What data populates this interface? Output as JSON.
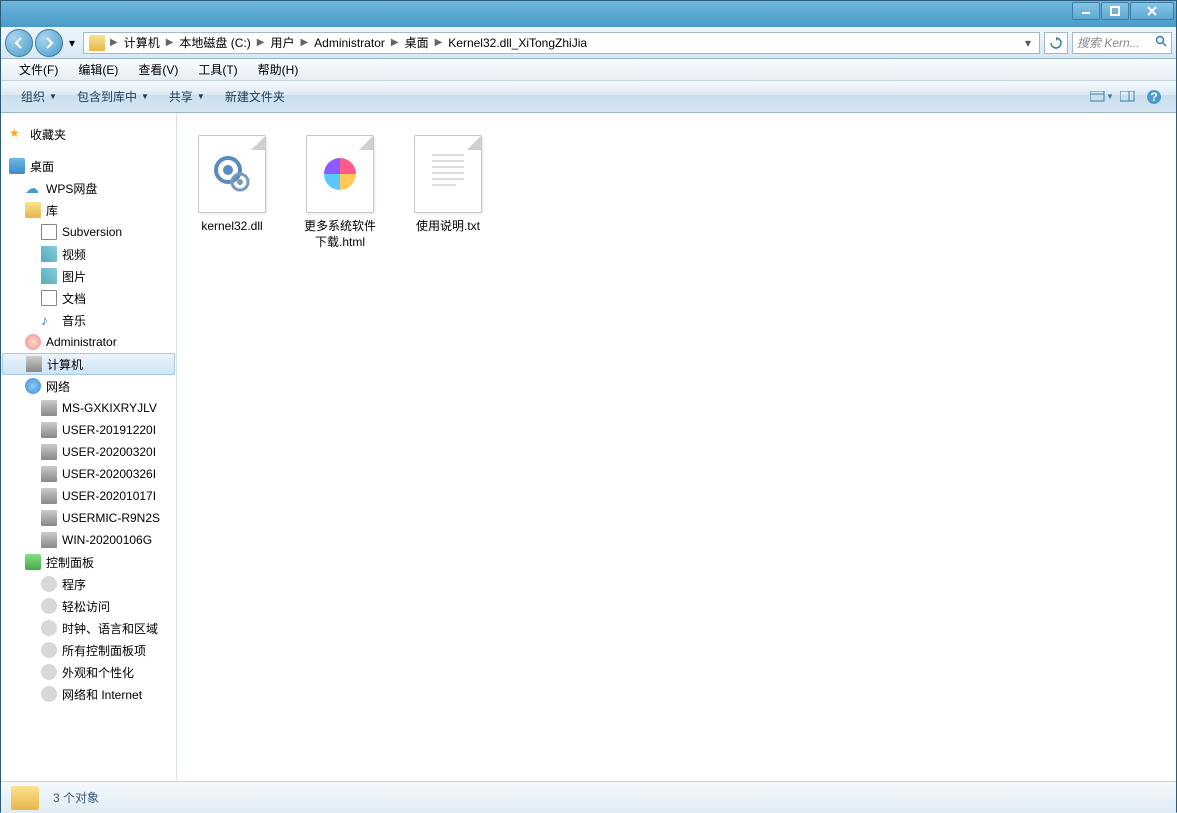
{
  "window_controls": {
    "minimize": "minimize",
    "maximize": "maximize",
    "close": "close"
  },
  "breadcrumb": {
    "items": [
      "计算机",
      "本地磁盘 (C:)",
      "用户",
      "Administrator",
      "桌面",
      "Kernel32.dll_XiTongZhiJia"
    ]
  },
  "search": {
    "placeholder": "搜索 Kern..."
  },
  "menubar": {
    "file": "文件(F)",
    "edit": "编辑(E)",
    "view": "查看(V)",
    "tools": "工具(T)",
    "help": "帮助(H)"
  },
  "toolbar": {
    "organize": "组织",
    "include": "包含到库中",
    "share": "共享",
    "new_folder": "新建文件夹"
  },
  "sidebar": {
    "favorites": "收藏夹",
    "desktop": "桌面",
    "wps": "WPS网盘",
    "library": "库",
    "subversion": "Subversion",
    "video": "视频",
    "pictures": "图片",
    "documents": "文档",
    "music": "音乐",
    "administrator": "Administrator",
    "computer": "计算机",
    "network": "网络",
    "net_items": [
      "MS-GXKIXRYJLV",
      "USER-20191220I",
      "USER-20200320I",
      "USER-20200326I",
      "USER-20201017I",
      "USERMIC-R9N2S",
      "WIN-20200106G"
    ],
    "control_panel": "控制面板",
    "cp_items": [
      "程序",
      "轻松访问",
      "时钟、语言和区域",
      "所有控制面板项",
      "外观和个性化",
      "网络和 Internet"
    ]
  },
  "files": [
    {
      "name": "kernel32.dll",
      "type": "dll"
    },
    {
      "name": "更多系统软件下载.html",
      "type": "html"
    },
    {
      "name": "使用说明.txt",
      "type": "txt"
    }
  ],
  "statusbar": {
    "count": "3 个对象"
  }
}
